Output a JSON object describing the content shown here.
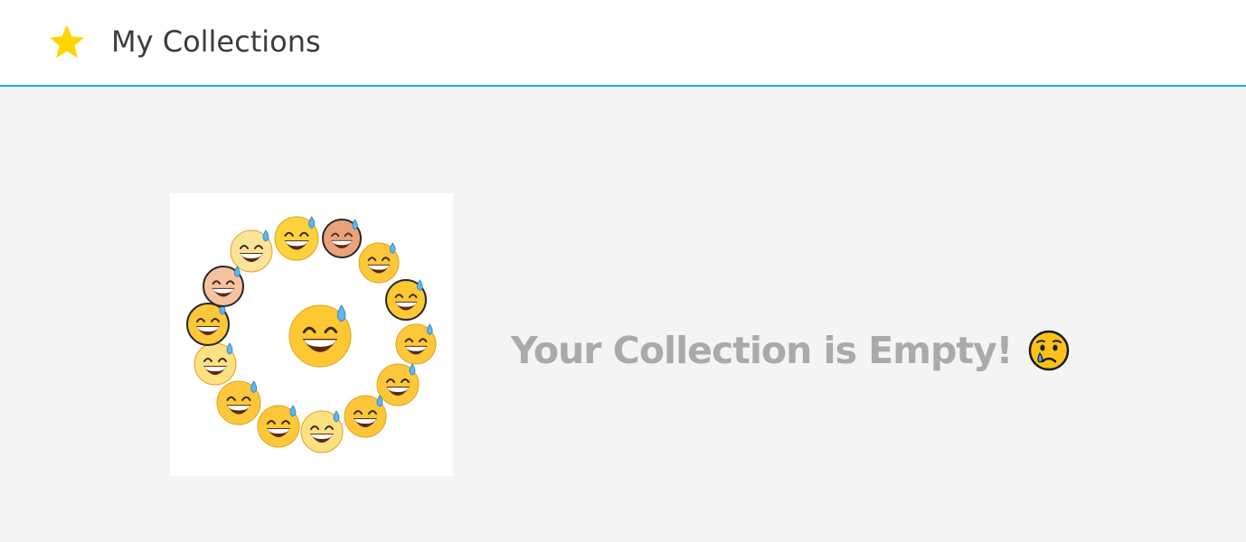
{
  "header": {
    "title": "My Collections",
    "star_icon": "star-icon",
    "star_color": "#ffd400",
    "accent_color": "#1ab0e8"
  },
  "main": {
    "empty_message": "Your Collection is Empty!",
    "sad_icon": "crying-face-icon",
    "illustration": "grinning-face-with-sweat-emoji-ring"
  }
}
